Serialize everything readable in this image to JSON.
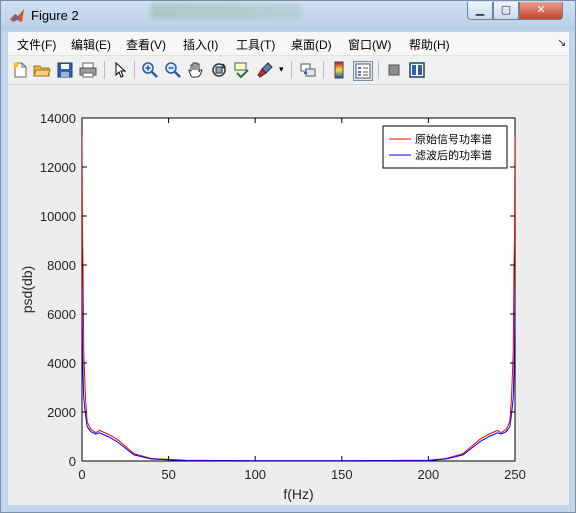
{
  "window": {
    "title": "Figure 2"
  },
  "menu": [
    "文件(F)",
    "编辑(E)",
    "查看(V)",
    "插入(I)",
    "工具(T)",
    "桌面(D)",
    "窗口(W)",
    "帮助(H)"
  ],
  "toolbar_icons": [
    "new-figure-icon",
    "open-file-icon",
    "save-icon",
    "print-icon",
    "pointer-icon",
    "zoom-in-icon",
    "zoom-out-icon",
    "pan-icon",
    "rotate-3d-icon",
    "data-cursor-icon",
    "brush-icon",
    "link-plot-icon",
    "colorbar-icon",
    "legend-icon",
    "hide-plot-tools-icon",
    "show-plot-tools-icon"
  ],
  "colors": {
    "series1": "#ff0000",
    "series2": "#0000ff",
    "figure_bg": "#ededed"
  },
  "chart_data": {
    "type": "line",
    "xlabel": "f(Hz)",
    "ylabel": "psd(db)",
    "xlim": [
      0,
      250
    ],
    "ylim": [
      0,
      14000
    ],
    "xticks": [
      0,
      50,
      100,
      150,
      200,
      250
    ],
    "yticks": [
      0,
      2000,
      4000,
      6000,
      8000,
      10000,
      12000,
      14000
    ],
    "legend_position": "top-right",
    "grid": false,
    "series": [
      {
        "name": "原始信号功率谱",
        "color": "#ff0000",
        "x": [
          0,
          0.3,
          0.6,
          1,
          2,
          3,
          5,
          8,
          10,
          15,
          20,
          30,
          40,
          60,
          100,
          150,
          200,
          210,
          220,
          230,
          235,
          240,
          242,
          245,
          247,
          248,
          249,
          249.4,
          249.7,
          250
        ],
        "values": [
          13300,
          9000,
          7800,
          4500,
          2600,
          1600,
          1300,
          1150,
          1250,
          1100,
          900,
          300,
          100,
          30,
          10,
          10,
          30,
          100,
          300,
          900,
          1100,
          1250,
          1150,
          1300,
          1600,
          2600,
          4500,
          7800,
          9000,
          13300
        ]
      },
      {
        "name": "滤波后的功率谱",
        "color": "#0000ff",
        "x": [
          0,
          0.3,
          0.6,
          1,
          2,
          3,
          5,
          8,
          10,
          15,
          20,
          30,
          40,
          60,
          100,
          150,
          200,
          210,
          220,
          230,
          235,
          240,
          242,
          245,
          247,
          248,
          249,
          249.4,
          249.7,
          250
        ],
        "values": [
          7000,
          4500,
          3600,
          2600,
          1900,
          1400,
          1200,
          1100,
          1150,
          1000,
          800,
          250,
          80,
          20,
          8,
          8,
          20,
          80,
          250,
          800,
          1000,
          1150,
          1100,
          1200,
          1400,
          1900,
          2600,
          3600,
          4500,
          7000
        ]
      }
    ]
  }
}
